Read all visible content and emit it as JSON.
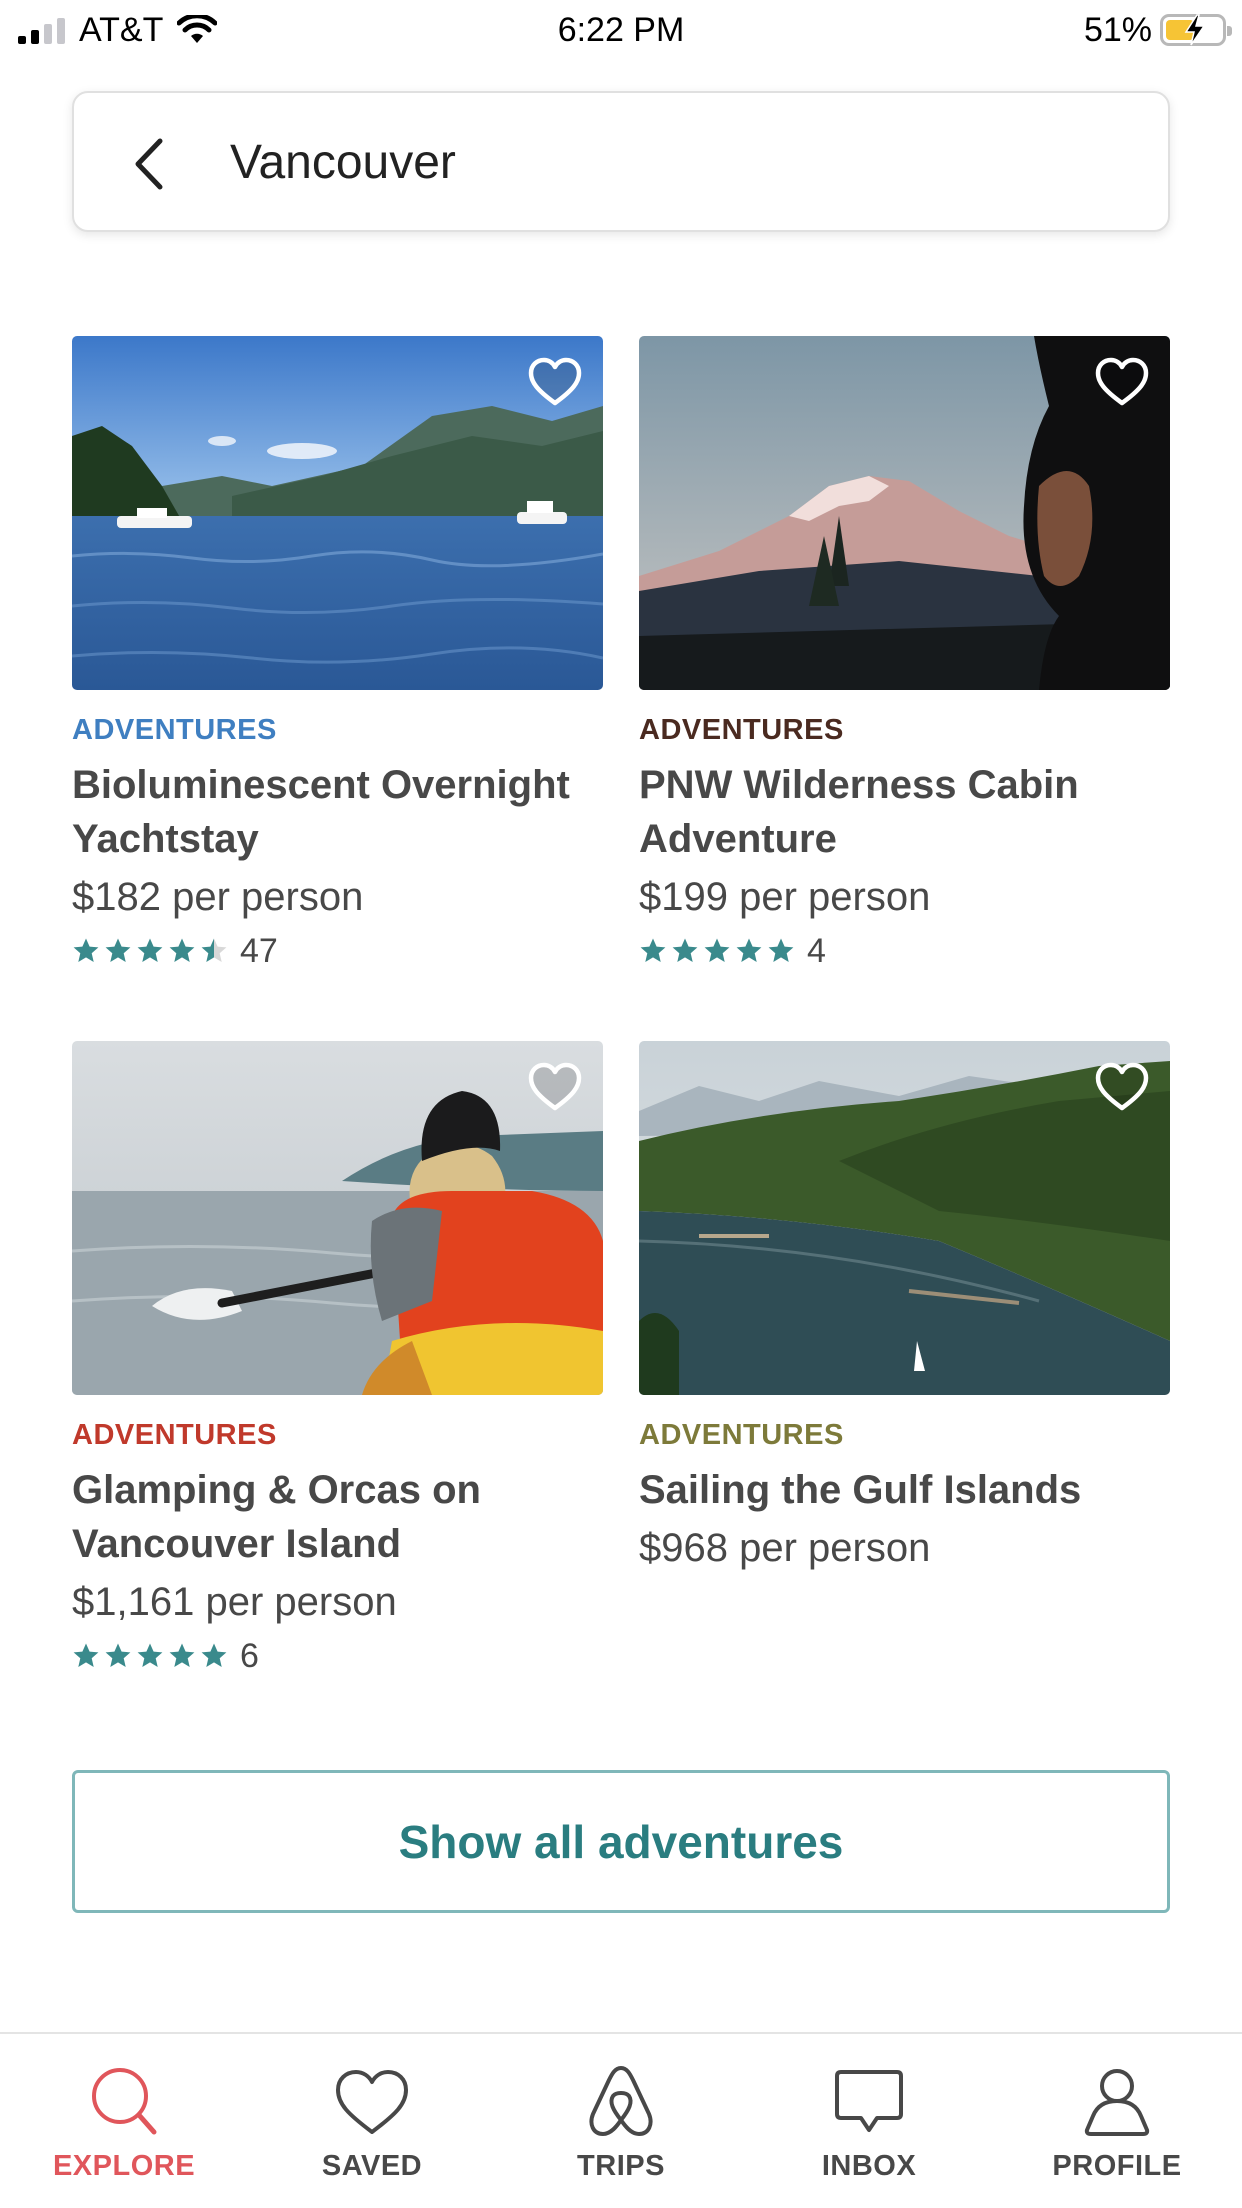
{
  "status_bar": {
    "carrier": "AT&T",
    "time": "6:22 PM",
    "battery_percent": "51%",
    "battery_level": 0.51,
    "signal_bars_active": 2,
    "signal_bars_total": 4
  },
  "header": {
    "title": "Vancouver",
    "back_icon": "chevron-left-icon"
  },
  "colors": {
    "accent_teal": "#2a7d80",
    "star_teal": "#3a8a8c",
    "explore_red": "#e0565b"
  },
  "cards": [
    {
      "category": "ADVENTURES",
      "category_color": "#3f7fc1",
      "title": "Bioluminescent Overnight Yachtstay",
      "price": "$182 per person",
      "rating": 4.5,
      "review_count": "47",
      "saved": false,
      "image": "lake-with-boats-and-mountains"
    },
    {
      "category": "ADVENTURES",
      "category_color": "#4a2a20",
      "title": "PNW Wilderness Cabin Adventure",
      "price": "$199 per person",
      "rating": 5,
      "review_count": "4",
      "saved": false,
      "image": "snowy-mountain-at-dusk-with-person"
    },
    {
      "category": "ADVENTURES",
      "category_color": "#c0392b",
      "title": "Glamping & Orcas on Vancouver Island",
      "price": "$1,161 per person",
      "rating": 5,
      "review_count": "6",
      "saved": false,
      "image": "kayaker-on-water"
    },
    {
      "category": "ADVENTURES",
      "category_color": "#7d7a3a",
      "title": "Sailing the Gulf Islands",
      "price": "$968 per person",
      "rating": null,
      "review_count": "",
      "saved": false,
      "image": "forested-bay-with-sailboats"
    }
  ],
  "show_all_label": "Show all adventures",
  "tabs": [
    {
      "label": "EXPLORE",
      "icon": "search-icon",
      "active": true
    },
    {
      "label": "SAVED",
      "icon": "heart-icon",
      "active": false
    },
    {
      "label": "TRIPS",
      "icon": "airbnb-logo-icon",
      "active": false
    },
    {
      "label": "INBOX",
      "icon": "chat-bubble-icon",
      "active": false
    },
    {
      "label": "PROFILE",
      "icon": "person-icon",
      "active": false
    }
  ]
}
